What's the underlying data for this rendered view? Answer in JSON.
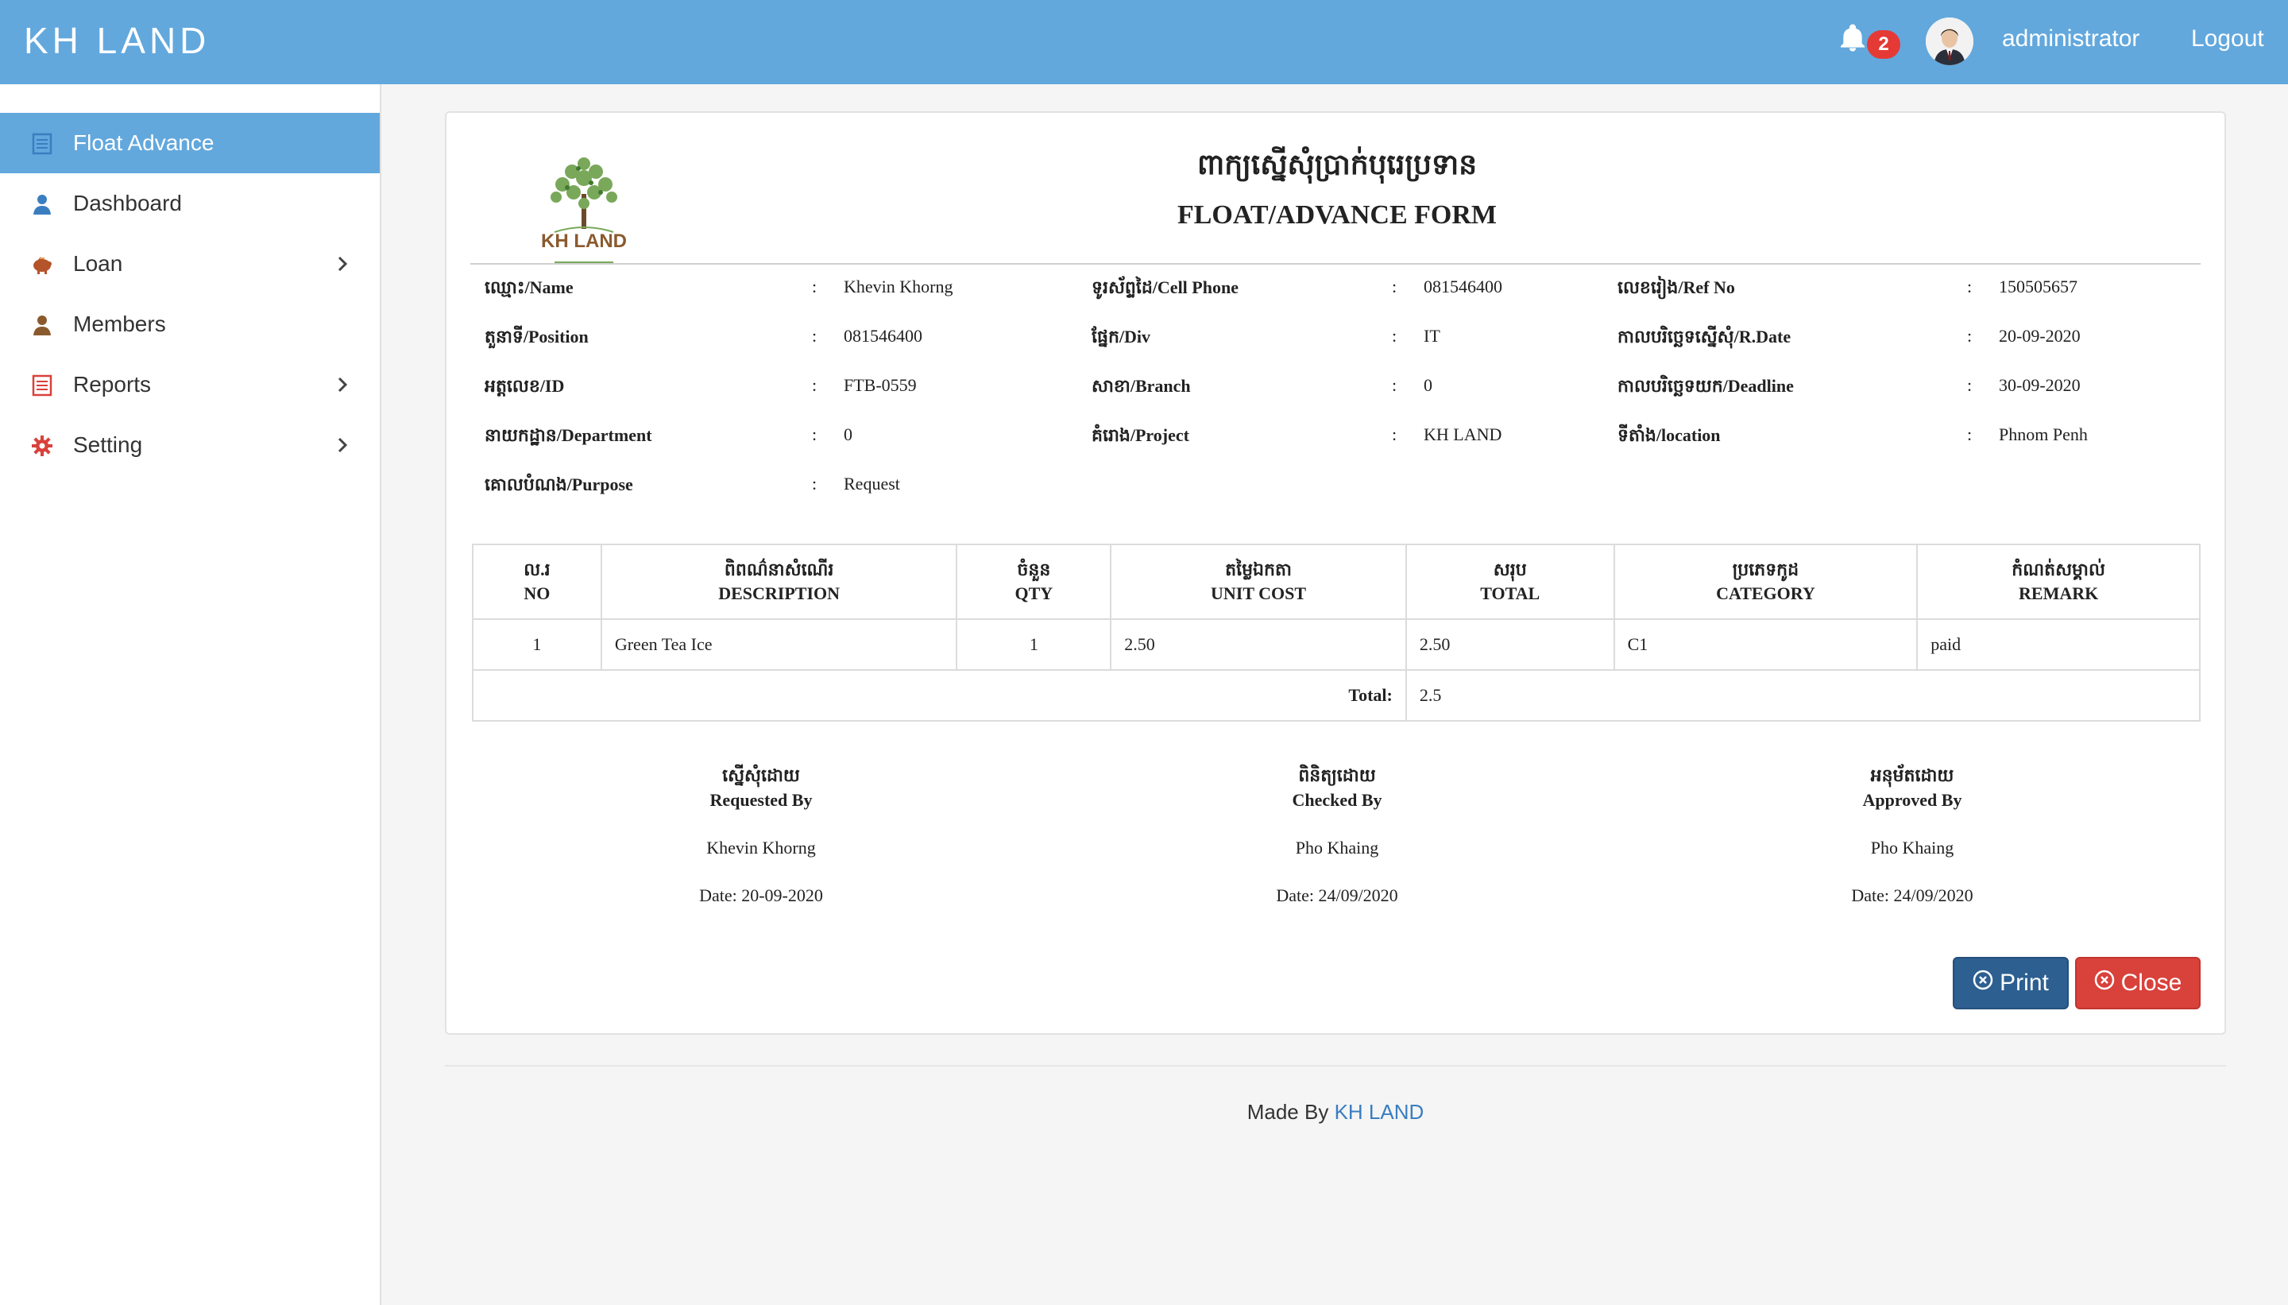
{
  "app": {
    "brand": "KH LAND"
  },
  "header": {
    "notification_count": "2",
    "user_name": "administrator",
    "logout_label": "Logout"
  },
  "sidebar": {
    "items": [
      {
        "label": "Float Advance",
        "icon": "document-icon",
        "active": true,
        "has_submenu": false
      },
      {
        "label": "Dashboard",
        "icon": "user-icon",
        "active": false,
        "has_submenu": false
      },
      {
        "label": "Loan",
        "icon": "piggy-bank-icon",
        "active": false,
        "has_submenu": true
      },
      {
        "label": "Members",
        "icon": "member-icon",
        "active": false,
        "has_submenu": false
      },
      {
        "label": "Reports",
        "icon": "report-icon",
        "active": false,
        "has_submenu": true
      },
      {
        "label": "Setting",
        "icon": "gear-icon",
        "active": false,
        "has_submenu": true
      }
    ]
  },
  "form": {
    "logo_text": "KH LAND",
    "title_kh": "ពាក្យស្នើសុំប្រាក់បុរេប្រទាន",
    "title_en": "FLOAT/ADVANCE FORM",
    "separator": ":",
    "fields": {
      "name": {
        "label": "ឈ្មោះ/Name",
        "value": "Khevin Khorng"
      },
      "position": {
        "label": "តួនាទី/Position",
        "value": "081546400"
      },
      "id": {
        "label": "អត្តលេខ/ID",
        "value": "FTB-0559"
      },
      "department": {
        "label": "នាយកដ្ឋាន/Department",
        "value": "0"
      },
      "purpose": {
        "label": "គោលបំណង/Purpose",
        "value": "Request"
      },
      "cell_phone": {
        "label": "ទូរស័ព្ទដៃ/Cell Phone",
        "value": "081546400"
      },
      "div": {
        "label": "ផ្នែក/Div",
        "value": "IT"
      },
      "branch": {
        "label": "សាខា/Branch",
        "value": "0"
      },
      "project": {
        "label": "គំរោង/Project",
        "value": "KH LAND"
      },
      "ref_no": {
        "label": "លេខរៀង/Ref No",
        "value": "150505657"
      },
      "r_date": {
        "label": "កាលបរិច្ឆេទស្នើសុំ/R.Date",
        "value": "20-09-2020"
      },
      "deadline": {
        "label": "កាលបរិច្ឆេទយក/Deadline",
        "value": "30-09-2020"
      },
      "location": {
        "label": "ទីតាំង/location",
        "value": "Phnom Penh"
      }
    },
    "table": {
      "headers": [
        {
          "kh": "ល.រ",
          "en": "NO"
        },
        {
          "kh": "ពិពណ៌នាសំណើរ",
          "en": "DESCRIPTION"
        },
        {
          "kh": "ចំនួន",
          "en": "QTY"
        },
        {
          "kh": "តម្លៃឯកតា",
          "en": "UNIT COST"
        },
        {
          "kh": "សរុប",
          "en": "TOTAL"
        },
        {
          "kh": "ប្រភេទកូដ",
          "en": "CATEGORY"
        },
        {
          "kh": "កំណត់សម្គាល់",
          "en": "REMARK"
        }
      ],
      "rows": [
        {
          "no": "1",
          "description": "Green Tea Ice",
          "qty": "1",
          "unit_cost": "2.50",
          "total": "2.50",
          "category": "C1",
          "remark": "paid"
        }
      ],
      "total_label": "Total:",
      "total_value": "2.5"
    },
    "signatures": {
      "requested": {
        "kh": "ស្នើសុំដោយ",
        "en": "Requested By",
        "name": "Khevin Khorng",
        "date": "Date: 20-09-2020"
      },
      "checked": {
        "kh": "ពិនិត្យដោយ",
        "en": "Checked By",
        "name": "Pho Khaing",
        "date": "Date: 24/09/2020"
      },
      "approved": {
        "kh": "អនុម័តដោយ",
        "en": "Approved By",
        "name": "Pho Khaing",
        "date": "Date: 24/09/2020"
      }
    },
    "buttons": {
      "print": "Print",
      "close": "Close"
    }
  },
  "footer": {
    "made_by": "Made By",
    "link": "KH LAND"
  },
  "colors": {
    "header": "#62a8dd",
    "active_item": "#62a8dd",
    "print_button": "#2d5f91",
    "close_button": "#d9413b",
    "badge": "#e53935",
    "link": "#3a7ec0"
  }
}
